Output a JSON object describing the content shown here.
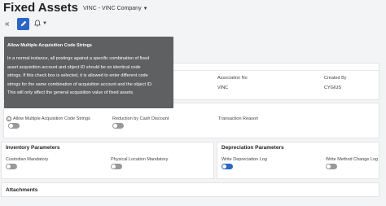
{
  "header": {
    "title": "Fixed Assets",
    "company": "VINC - VINC Company"
  },
  "toolbar": {
    "back_icon": "double-chevron-left-icon",
    "edit_icon": "pencil-icon",
    "bell_icon": "bell-icon"
  },
  "tooltip": {
    "title": "Allow Multiple Acquisition Code Strings",
    "lines": [
      "In a normal instance, all postings against a specific combination of fixed",
      "asset acquisition account and object ID should be on identical code",
      "strings. If this check box is selected, it is allowed to enter different code",
      "strings for the same combination of acquisition account and the object ID.",
      "This will only affect the general acquisition value of fixed assets."
    ]
  },
  "general": {
    "association_label": "Association No",
    "association_value": "VINC",
    "created_by_label": "Created By",
    "created_by_value": "CYGIUS"
  },
  "options": {
    "allow_multiple_label": "Allow Multiple Acquisition Code Strings",
    "reduction_label": "Reduction by Cash Discount",
    "transaction_reason_label": "Transaction Reason"
  },
  "inventory": {
    "title": "Inventory Parameters",
    "custodian_label": "Custodian Mandatory",
    "physical_location_label": "Physical Location Mandatory"
  },
  "depreciation": {
    "title": "Depreciation Parameters",
    "write_log_label": "Write Depreciation Log",
    "write_method_label": "Write Method Change Log"
  },
  "attachments": {
    "title": "Attachments"
  },
  "colors": {
    "accent": "#2b66c4",
    "tooltip_bg": "#5f6061"
  }
}
